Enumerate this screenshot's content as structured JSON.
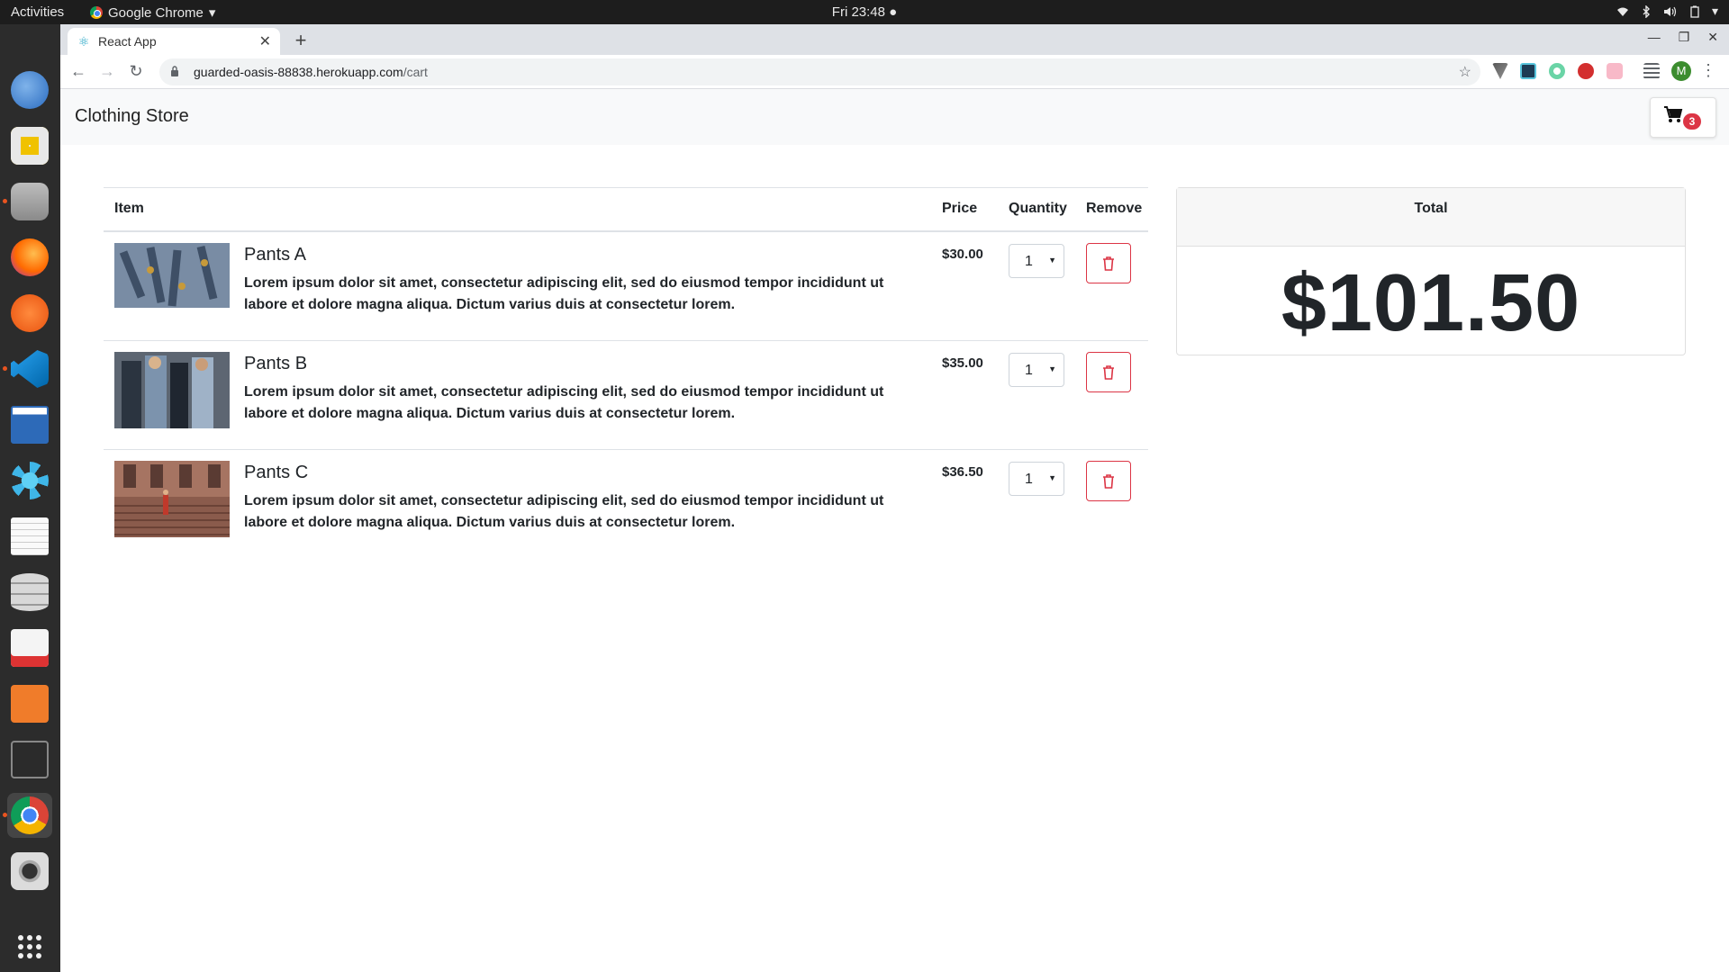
{
  "system": {
    "activities": "Activities",
    "app_menu": "Google Chrome",
    "clock": "Fri 23:48"
  },
  "dock": {
    "items": [
      "thunderbird",
      "rhythmbox",
      "files",
      "firefox",
      "pencil",
      "vscode",
      "writer",
      "settings",
      "text-editor",
      "database",
      "evince",
      "software",
      "terminal",
      "chrome",
      "camera",
      "show-apps"
    ]
  },
  "browser": {
    "tab_title": "React App",
    "url_host": "guarded-oasis-88838.herokuapp.com",
    "url_path": "/cart",
    "profile_initial": "M"
  },
  "navbar": {
    "brand": "Clothing Store",
    "cart_count": "3"
  },
  "cart": {
    "headers": {
      "item": "Item",
      "price": "Price",
      "quantity": "Quantity",
      "remove": "Remove"
    },
    "items": [
      {
        "name": "Pants A",
        "description": "Lorem ipsum dolor sit amet, consectetur adipiscing elit, sed do eiusmod tempor incididunt ut labore et dolore magna aliqua. Dictum varius duis at consectetur lorem.",
        "price": "$30.00",
        "quantity": "1"
      },
      {
        "name": "Pants B",
        "description": "Lorem ipsum dolor sit amet, consectetur adipiscing elit, sed do eiusmod tempor incididunt ut labore et dolore magna aliqua. Dictum varius duis at consectetur lorem.",
        "price": "$35.00",
        "quantity": "1"
      },
      {
        "name": "Pants C",
        "description": "Lorem ipsum dolor sit amet, consectetur adipiscing elit, sed do eiusmod tempor incididunt ut labore et dolore magna aliqua. Dictum varius duis at consectetur lorem.",
        "price": "$36.50",
        "quantity": "1"
      }
    ]
  },
  "total": {
    "label": "Total",
    "amount": "$101.50"
  },
  "colors": {
    "danger": "#dc3545",
    "navbar_bg": "#f8f9fa",
    "dock_bg": "#2c2c2c",
    "topbar_bg": "#1d1d1d"
  }
}
